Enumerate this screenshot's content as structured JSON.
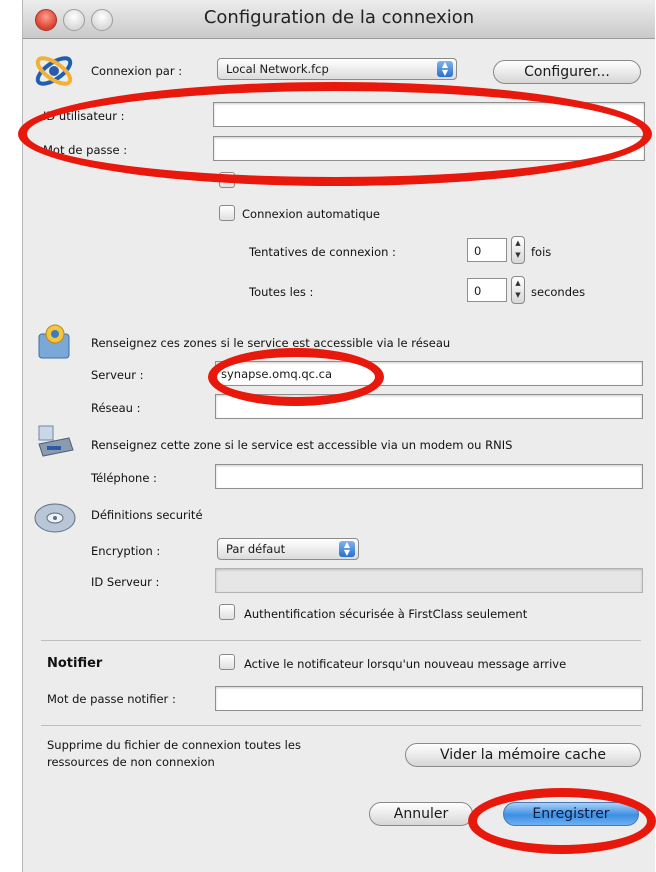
{
  "window": {
    "title": "Configuration de la connexion"
  },
  "connection": {
    "via_label": "Connexion par :",
    "via_value": "Local Network.fcp",
    "configure_button": "Configurer...",
    "user_id_label": "ID utilisateur :",
    "user_id_value": "",
    "password_label": "Mot de passe :",
    "password_value": "",
    "auto_connect_label": "Connexion automatique",
    "attempts_label": "Tentatives de connexion :",
    "attempts_value": "0",
    "attempts_unit": "fois",
    "every_label": "Toutes les :",
    "every_value": "0",
    "every_unit": "secondes"
  },
  "network": {
    "note": "Renseignez ces zones si le service est accessible via le réseau",
    "server_label": "Serveur :",
    "server_value": "synapse.omq.qc.ca",
    "network_label": "Réseau :",
    "network_value": ""
  },
  "modem": {
    "note": "Renseignez cette zone si le service est accessible via un modem ou RNIS",
    "phone_label": "Téléphone :",
    "phone_value": ""
  },
  "security": {
    "title": "Définitions securité",
    "encryption_label": "Encryption :",
    "encryption_value": "Par défaut",
    "server_id_label": "ID Serveur :",
    "server_id_value": "",
    "secure_auth_label": "Authentification sécurisée à FirstClass seulement"
  },
  "notifier": {
    "title": "Notifier",
    "activate_label": "Active le notificateur lorsqu'un nouveau message arrive",
    "password_label": "Mot de passe notifier :",
    "password_value": ""
  },
  "cache": {
    "note_line1": "Supprime du fichier de connexion toutes les",
    "note_line2": "ressources de non connexion",
    "clear_button": "Vider la mémoire cache"
  },
  "actions": {
    "cancel": "Annuler",
    "save": "Enregistrer"
  },
  "icons": [
    "connection-icon",
    "network-server-icon",
    "modem-icon",
    "security-disc-icon"
  ],
  "colors": {
    "annotation": "#e8180c",
    "default_button": "#3d8fe3"
  }
}
